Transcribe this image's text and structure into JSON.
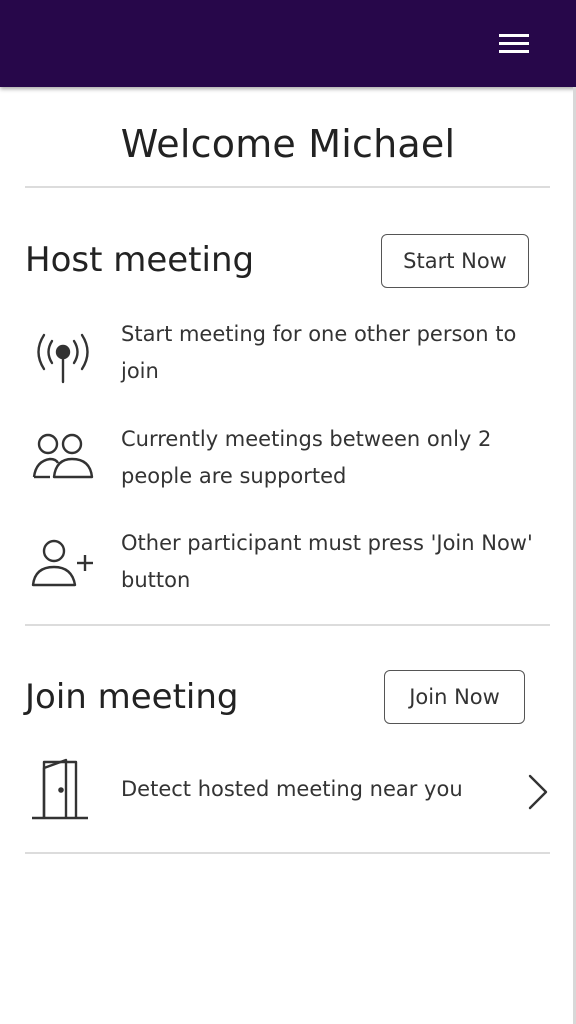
{
  "header": {
    "menu_icon": "hamburger-menu-icon",
    "bg_color": "#27074a"
  },
  "welcome": {
    "title": "Welcome Michael"
  },
  "host": {
    "heading": "Host meeting",
    "button_label": "Start Now",
    "items": [
      {
        "icon": "broadcast-icon",
        "text": "Start meeting for one other person to join"
      },
      {
        "icon": "people-icon",
        "text": "Currently meetings between only 2 people are supported"
      },
      {
        "icon": "add-person-icon",
        "text": "Other participant must press 'Join Now' button"
      }
    ]
  },
  "join": {
    "heading": "Join meeting",
    "button_label": "Join Now",
    "items": [
      {
        "icon": "door-icon",
        "text": "Detect hosted meeting near you",
        "chevron": "chevron-right-icon"
      }
    ]
  }
}
